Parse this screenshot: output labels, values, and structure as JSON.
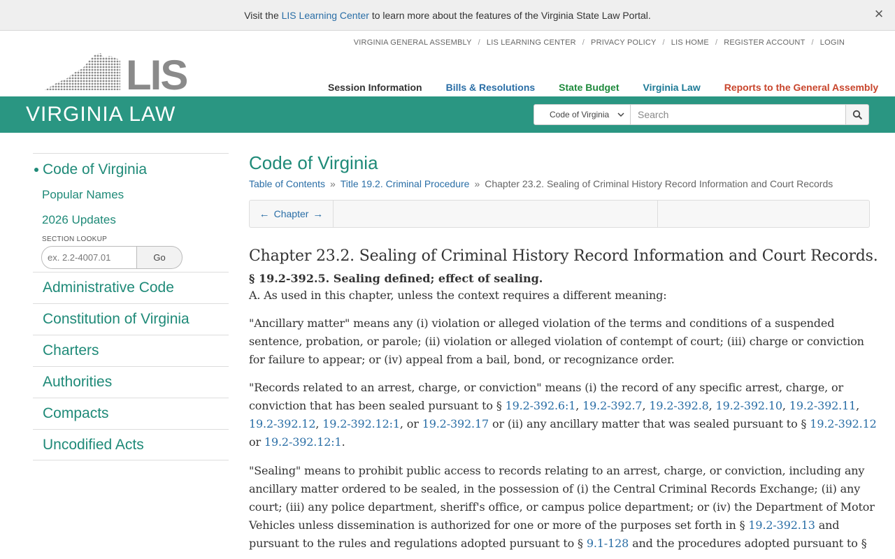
{
  "banner": {
    "prefix": "Visit the",
    "link": "LIS Learning Center",
    "suffix": "to learn more about the features of the Virginia State Law Portal.",
    "close": "×"
  },
  "header": {
    "logo_text": "LIS",
    "top_links": [
      "VIRGINIA GENERAL ASSEMBLY",
      "LIS LEARNING CENTER",
      "PRIVACY POLICY",
      "LIS HOME",
      "REGISTER ACCOUNT",
      "LOGIN"
    ],
    "top_sep": "/",
    "nav": [
      "Session Information",
      "Bills & Resolutions",
      "State Budget",
      "Virginia Law",
      "Reports to the General Assembly"
    ]
  },
  "band": {
    "title": "VIRGINIA LAW",
    "search_scope": "Code of Virginia",
    "search_placeholder": "Search"
  },
  "sidebar": {
    "current": "Code of Virginia",
    "sub_items": [
      "Popular Names",
      "2026 Updates"
    ],
    "lookup_label": "SECTION LOOKUP",
    "lookup_placeholder": "ex. 2.2-4007.01",
    "lookup_button": "Go",
    "items": [
      "Administrative Code",
      "Constitution of Virginia",
      "Charters",
      "Authorities",
      "Compacts",
      "Uncodified Acts"
    ]
  },
  "main": {
    "title": "Code of Virginia",
    "breadcrumb": [
      "Table of Contents",
      "Title 19.2. Criminal Procedure",
      "Chapter 23.2. Sealing of Criminal History Record Information and Court Records"
    ],
    "breadcrumb_sep": "»",
    "chapter_nav": {
      "prev": "←",
      "label": "Chapter",
      "next": "→"
    },
    "chapter_title": "Chapter 23.2. Sealing of Criminal History Record Information and Court Records.",
    "section_heading": "§ 19.2-392.5. Sealing defined; effect of sealing.",
    "p0": "A. As used in this chapter, unless the context requires a different meaning:",
    "p1": "\"Ancillary matter\" means any (i) violation or alleged violation of the terms and conditions of a suspended sentence, probation, or parole; (ii) violation or alleged violation of contempt of court; (iii) charge or conviction for failure to appear; or (iv) appeal from a bail, bond, or recognizance order.",
    "p2": {
      "t1": "\"Records related to an arrest, charge, or conviction\" means (i) the record of any specific arrest, charge, or conviction that has been sealed pursuant to § ",
      "l1": "19.2-392.6:1",
      "c1": ", ",
      "l2": "19.2-392.7",
      "c2": ", ",
      "l3": "19.2-392.8",
      "c3": ", ",
      "l4": "19.2-392.10",
      "c4": ", ",
      "l5": "19.2-392.11",
      "c5": ", ",
      "l6": "19.2-392.12",
      "c6": ", ",
      "l7": "19.2-392.12:1",
      "c7": ", or ",
      "l8": "19.2-392.17",
      "t2": " or (ii) any ancillary matter that was sealed pursuant to § ",
      "l9": "19.2-392.12",
      "t3": " or ",
      "l10": "19.2-392.12:1",
      "t4": "."
    },
    "p3": {
      "t1": "\"Sealing\" means to prohibit public access to records relating to an arrest, charge, or conviction, including any ancillary matter ordered to be sealed, in the possession of (i) the Central Criminal Records Exchange; (ii) any court; (iii) any police department, sheriff's office, or campus police department; or (iv) the Department of Motor Vehicles unless dissemination is authorized for one or more of the purposes set forth in § ",
      "l1": "19.2-392.13",
      "t2": " and pursuant to the rules and regulations adopted pursuant to § ",
      "l2": "9.1-128",
      "t3": " and the procedures adopted pursuant to §"
    }
  },
  "colors": {
    "teal": "#2a9682",
    "link": "#2a6ea6",
    "sidebar_link": "#1f8a78"
  }
}
